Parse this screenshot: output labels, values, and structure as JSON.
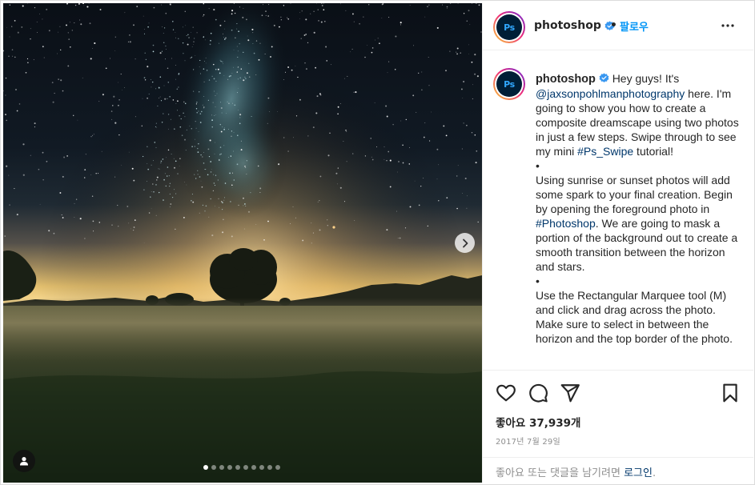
{
  "post": {
    "username": "photoshop",
    "avatar_text": "Ps",
    "follow_separator": "•",
    "follow_label": "팔로우",
    "caption_parts": {
      "p1_a": "Hey guys! It's ",
      "mention": "@jaxsonpohlmanphotography",
      "p1_b": " here. I'm going to show you how to create a composite dreamscape using two photos in just a few steps. Swipe through to see my mini ",
      "hashtag1": "#Ps_Swipe",
      "p1_c": " tutorial!",
      "bullet1": "•",
      "p2_a": "Using sunrise or sunset photos will add some spark to your final creation. Begin by opening the foreground photo in ",
      "hashtag2": "#Photoshop",
      "p2_b": ". We are going to mask a portion of the background out to create a smooth transition between the horizon and stars.",
      "bullet2": "•",
      "p3": "Use the Rectangular Marquee tool (M) and click and drag across the photo. Make sure to select in between the horizon and the top border of the photo."
    },
    "likes_text": "좋아요 37,939개",
    "date_text": "2017년 7월 29일",
    "login_prompt": "좋아요 또는 댓글을 남기려면 ",
    "login_link": "로그인",
    "login_suffix": "."
  },
  "carousel": {
    "slide_count": 10,
    "active_index": 0
  },
  "icons": {
    "verified": "verified-badge-icon",
    "more": "more-options-icon",
    "next": "chevron-right-icon",
    "tag": "user-tag-icon",
    "like": "heart-icon",
    "comment": "comment-icon",
    "share": "paper-plane-icon",
    "save": "bookmark-icon"
  },
  "colors": {
    "link": "#00376b",
    "follow": "#0095f6",
    "verified": "#3897f0",
    "border": "#dbdbdb",
    "muted": "#8e8e8e"
  }
}
